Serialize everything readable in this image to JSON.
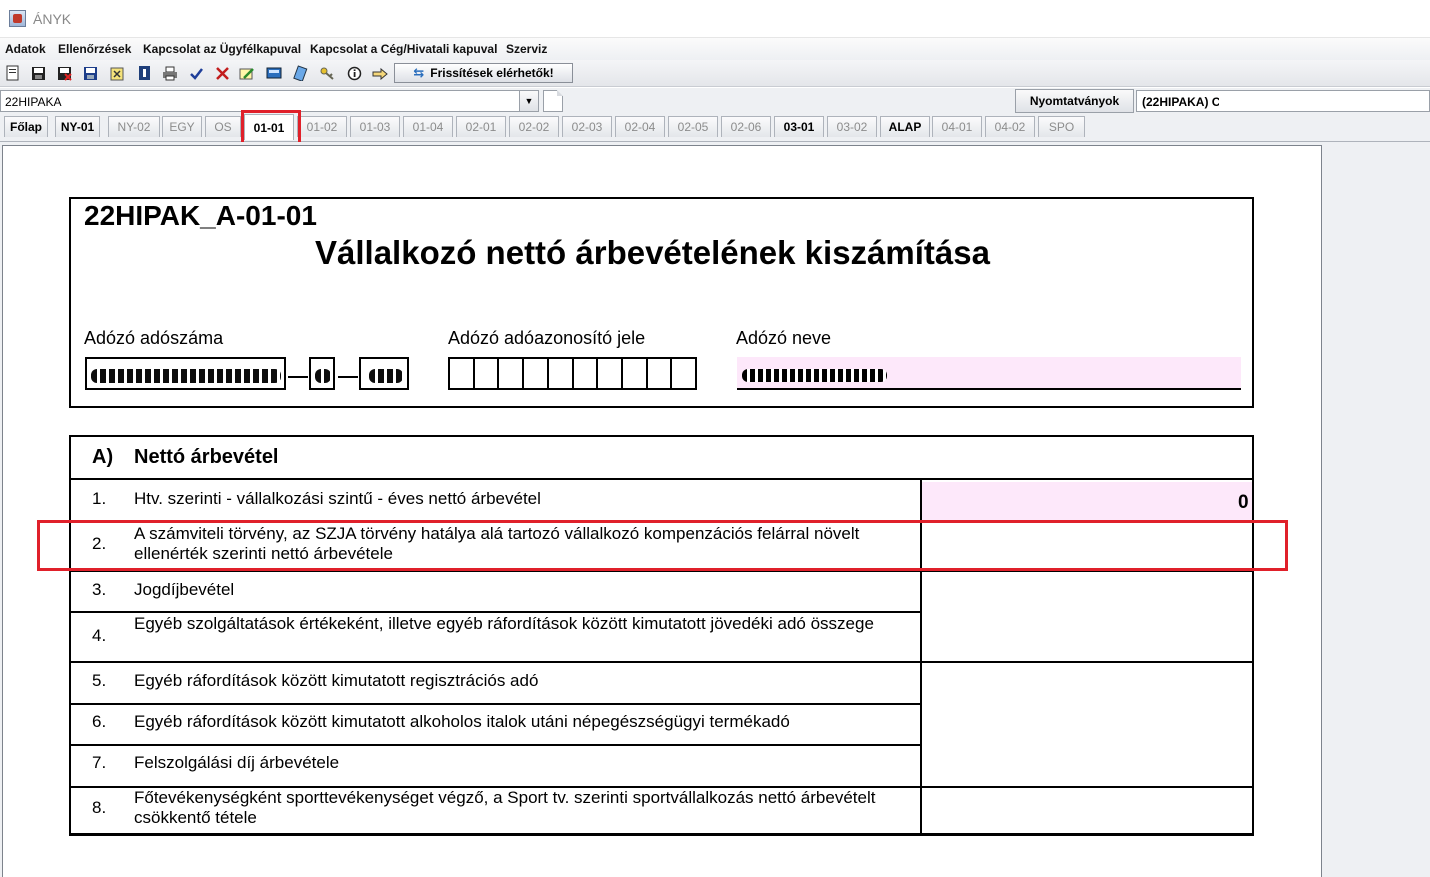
{
  "window": {
    "title": "ÁNYK"
  },
  "menu": [
    "Adatok",
    "Ellenőrzések",
    "Kapcsolat az Ügyfélkapuval",
    "Kapcsolat a Cég/Hivatali kapuval",
    "Szerviz"
  ],
  "toolbar": {
    "icons": [
      "new-document-icon",
      "save-icon",
      "save-close-icon",
      "save-as-icon",
      "attachment-icon",
      "info-book-icon",
      "print-icon",
      "check-icon",
      "delete-icon",
      "edit-icon",
      "calculator-icon",
      "clipboard-icon",
      "key-icon",
      "info-icon",
      "hand-pointer-icon"
    ],
    "refresh_label": "Frissítések elérhetők!"
  },
  "selector": {
    "combo_value": "22HIPAKA",
    "forms_button": "Nyomtatványok",
    "forms_field_value": "(22HIPAKA) C"
  },
  "tabs": [
    {
      "label": "Főlap",
      "state": "bold"
    },
    {
      "label": "NY-01",
      "state": "bold"
    },
    {
      "label": "NY-02",
      "state": "normal"
    },
    {
      "label": "EGY",
      "state": "normal"
    },
    {
      "label": "OS",
      "state": "normal"
    },
    {
      "label": "01-01",
      "state": "active"
    },
    {
      "label": "01-02",
      "state": "normal"
    },
    {
      "label": "01-03",
      "state": "normal"
    },
    {
      "label": "01-04",
      "state": "normal"
    },
    {
      "label": "02-01",
      "state": "normal"
    },
    {
      "label": "02-02",
      "state": "normal"
    },
    {
      "label": "02-03",
      "state": "normal"
    },
    {
      "label": "02-04",
      "state": "normal"
    },
    {
      "label": "02-05",
      "state": "normal"
    },
    {
      "label": "02-06",
      "state": "normal"
    },
    {
      "label": "03-01",
      "state": "bold"
    },
    {
      "label": "03-02",
      "state": "normal"
    },
    {
      "label": "ALAP",
      "state": "bold"
    },
    {
      "label": "04-01",
      "state": "normal"
    },
    {
      "label": "04-02",
      "state": "normal"
    },
    {
      "label": "SPO",
      "state": "normal"
    }
  ],
  "form": {
    "code": "22HIPAK_A-01-01",
    "title": "Vállalkozó nettó árbevételének kiszámítása",
    "labels": {
      "tax_number": "Adózó adószáma",
      "tax_id": "Adózó adóazonosító jele",
      "name": "Adózó neve"
    }
  },
  "section": {
    "letter": "A)",
    "title": "Nettó árbevétel",
    "rows": [
      {
        "num": "1.",
        "text": "Htv. szerinti - vállalkozási szintű - éves nettó árbevétel",
        "value": "0"
      },
      {
        "num": "2.",
        "text": "A számviteli törvény, az SZJA törvény hatálya alá tartozó vállalkozó kompenzációs felárral növelt ellenérték szerinti nettó árbevétele",
        "value": ""
      },
      {
        "num": "3.",
        "text": "Jogdíjbevétel",
        "value": ""
      },
      {
        "num": "4.",
        "text": "Egyéb szolgáltatások értékeként, illetve egyéb ráfordítások között kimutatott jövedéki adó összege",
        "value": ""
      },
      {
        "num": "5.",
        "text": "Egyéb ráfordítások között kimutatott regisztrációs adó",
        "value": ""
      },
      {
        "num": "6.",
        "text": "Egyéb ráfordítások között kimutatott alkoholos italok utáni népegészségügyi termékadó",
        "value": ""
      },
      {
        "num": "7.",
        "text": "Felszolgálási díj árbevétele",
        "value": ""
      },
      {
        "num": "8.",
        "text": "Főtevékenységként sporttevékenységet végző, a Sport tv. szerinti sportvállalkozás nettó árbevételt csökkentő tétele",
        "value": ""
      }
    ]
  },
  "colors": {
    "highlight": "#e0202a",
    "field_pink": "#fde8fa"
  }
}
